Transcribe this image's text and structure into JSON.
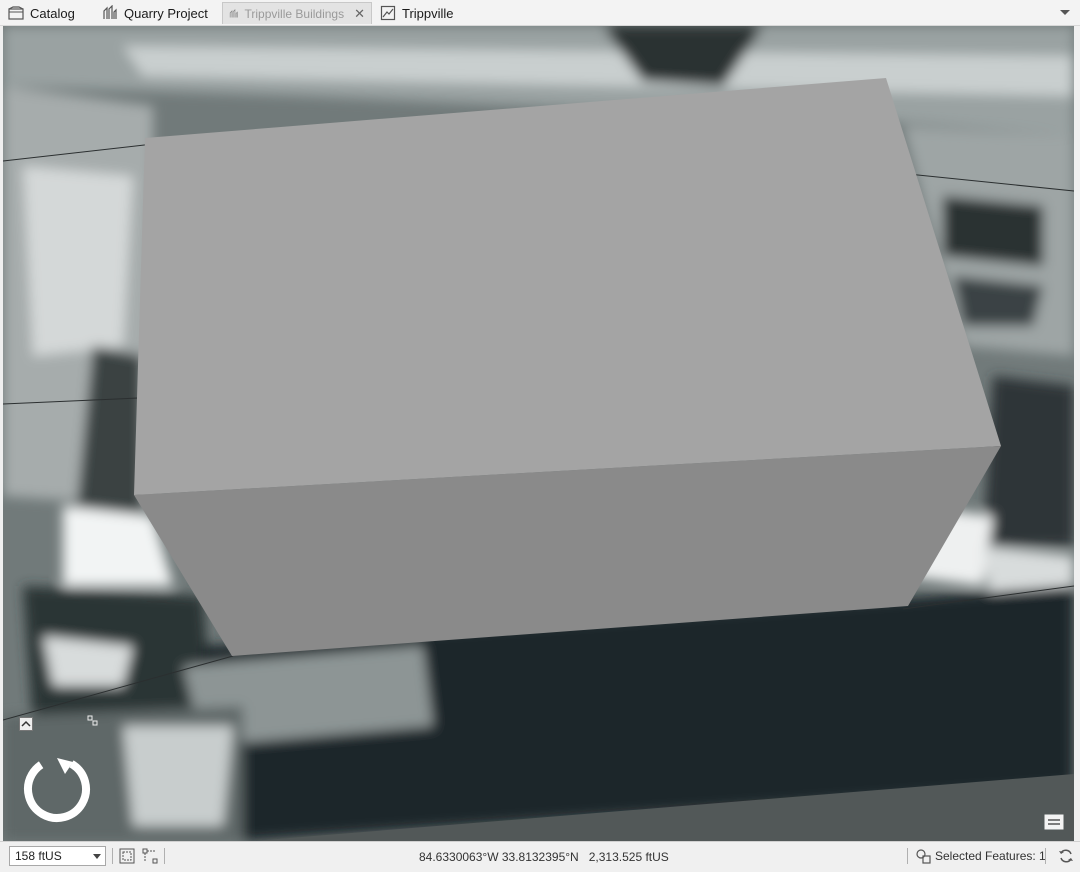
{
  "tabs": [
    {
      "label": "Catalog",
      "icon": "catalog-icon",
      "active": false
    },
    {
      "label": "Quarry Project",
      "icon": "scene-icon",
      "active": false
    },
    {
      "label": "Trippville Buildings",
      "icon": "scene-icon",
      "active": true
    },
    {
      "label": "Trippville",
      "icon": "map-icon",
      "active": false
    }
  ],
  "statusbar": {
    "scale": "158 ftUS",
    "coordinates": "84.6330063°W 33.8132395°N",
    "elevation": "2,313.525 ftUS",
    "selected_features": "Selected Features: 1"
  },
  "colors": {
    "roof": "#a4a4a4",
    "wall": "#8a8a8a",
    "ground": "#5b6464",
    "ui_background": "#f0f0f0"
  }
}
